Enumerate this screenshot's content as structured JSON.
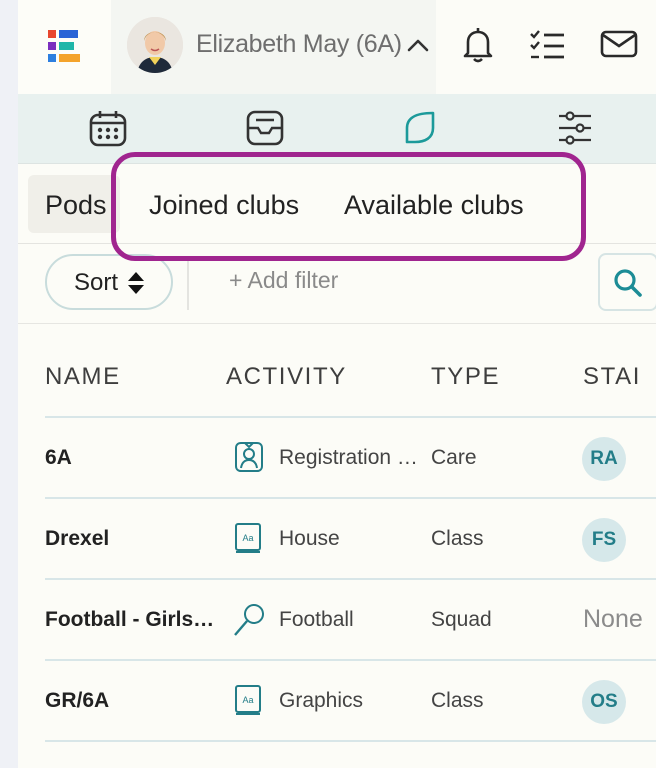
{
  "header": {
    "user_name": "Elizabeth May (6A)",
    "icons": [
      "bell-icon",
      "checklist-icon",
      "mail-icon"
    ]
  },
  "icon_nav": [
    "calendar-icon",
    "inbox-icon",
    "leaf-icon",
    "sliders-icon"
  ],
  "tabs": [
    {
      "label": "Pods"
    },
    {
      "label": "Joined clubs"
    },
    {
      "label": "Available clubs"
    }
  ],
  "filter": {
    "sort_label": "Sort",
    "add_filter_label": "+ Add filter"
  },
  "table": {
    "headers": [
      "NAME",
      "ACTIVITY",
      "TYPE",
      "STAI"
    ],
    "rows": [
      {
        "name": "6A",
        "activity": "Registration …",
        "activity_icon": "person-badge-icon",
        "type": "Care",
        "staff": "RA"
      },
      {
        "name": "Drexel",
        "activity": "House",
        "activity_icon": "book-icon",
        "type": "Class",
        "staff": "FS"
      },
      {
        "name": "Football - Girls…",
        "activity": "Football",
        "activity_icon": "racket-icon",
        "type": "Squad",
        "staff": "None"
      },
      {
        "name": "GR/6A",
        "activity": "Graphics",
        "activity_icon": "book-icon",
        "type": "Class",
        "staff": "OS"
      }
    ]
  },
  "colors": {
    "accent": "#237d88",
    "annotation": "#a0258f",
    "badge_bg": "#d6e8ea"
  }
}
